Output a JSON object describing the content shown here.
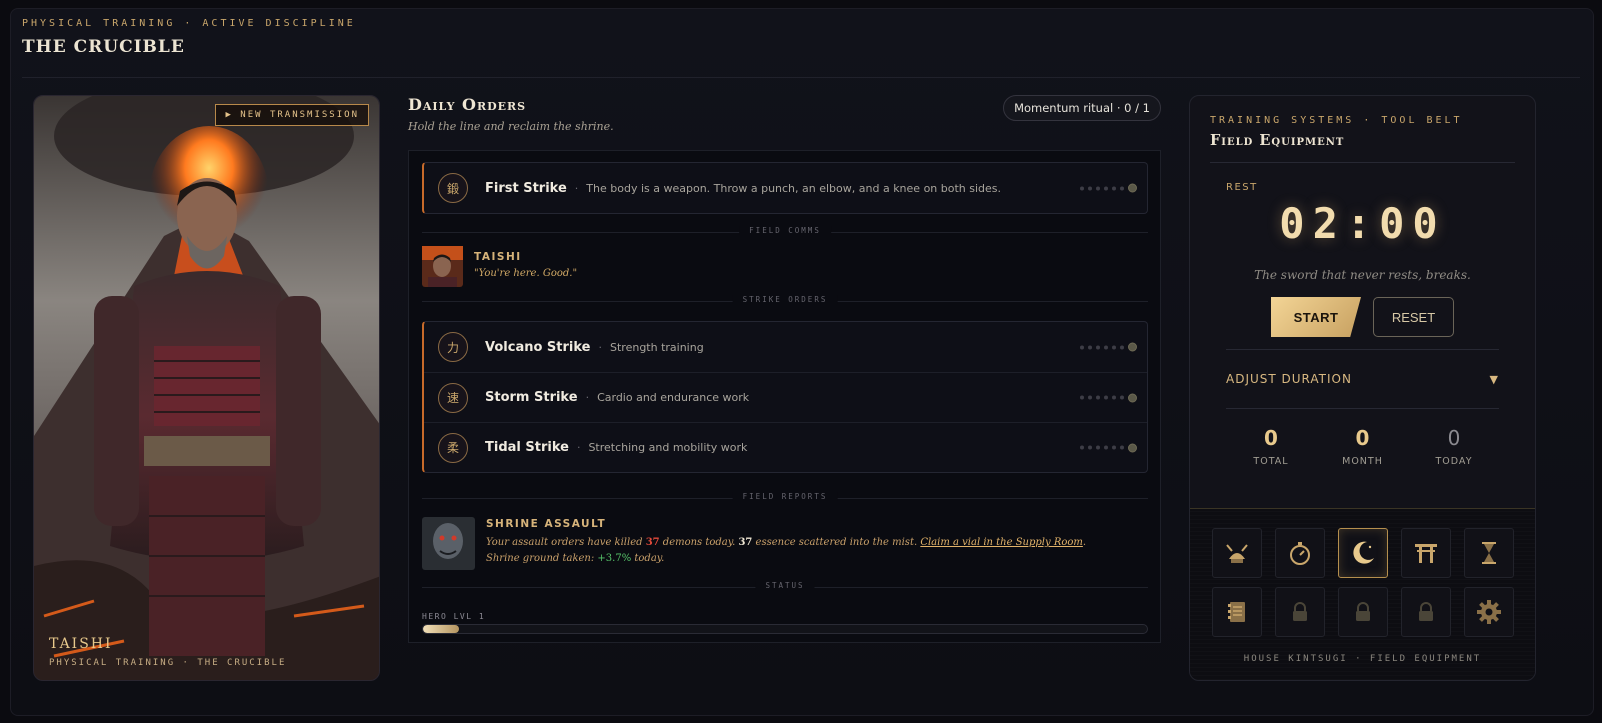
{
  "header": {
    "eyebrow": "PHYSICAL TRAINING · ACTIVE DISCIPLINE",
    "title": "THE CRUCIBLE"
  },
  "hero": {
    "badge": "▶ NEW TRANSMISSION",
    "name": "TAISHI",
    "subtitle": "PHYSICAL TRAINING · THE CRUCIBLE"
  },
  "orders": {
    "title": "Daily Orders",
    "subtitle": "Hold the line and reclaim the shrine.",
    "ritual": "Momentum ritual · 0 / 1",
    "first_strike": {
      "kanji": "鍛",
      "name": "First Strike",
      "sep": "·",
      "desc": "The body is a weapon. Throw a punch, an elbow, and a knee on both sides."
    },
    "dividers": {
      "comms": "FIELD COMMS",
      "strikes": "STRIKE ORDERS",
      "reports": "FIELD REPORTS",
      "status": "STATUS"
    },
    "comm": {
      "who": "TAISHI",
      "quote": "\"You're here. Good.\""
    },
    "strikes": [
      {
        "kanji": "力",
        "name": "Volcano Strike",
        "sep": "·",
        "desc": "Strength training"
      },
      {
        "kanji": "速",
        "name": "Storm Strike",
        "sep": "·",
        "desc": "Cardio and endurance work"
      },
      {
        "kanji": "柔",
        "name": "Tidal Strike",
        "sep": "·",
        "desc": "Stretching and mobility work"
      }
    ],
    "report": {
      "title": "SHRINE ASSAULT",
      "l1_a": "Your assault orders have killed ",
      "kills": "37",
      "l1_b": " demons today. ",
      "essence": "37",
      "l1_c": " essence scattered into the mist. ",
      "link": "Claim a vial in the Supply Room",
      "l1_d": ".",
      "l2_a": "Shrine ground taken: ",
      "gain": "+3.7%",
      "l2_b": " today."
    },
    "level": "HERO LVL 1",
    "xp_fraction": 0.05
  },
  "equipment": {
    "eyebrow": "TRAINING SYSTEMS · TOOL BELT",
    "title": "Field Equipment",
    "rest_label": "REST",
    "timer": "02:00",
    "motto": "The sword that never rests, breaks.",
    "start": "START",
    "reset": "RESET",
    "adjust": "ADJUST DURATION",
    "adjust_chev": "▼",
    "stats": [
      {
        "num": "0",
        "label": "TOTAL"
      },
      {
        "num": "0",
        "label": "MONTH"
      },
      {
        "num": "0",
        "label": "TODAY"
      }
    ],
    "tools": [
      "samurai-helmet-icon",
      "stopwatch-icon",
      "moon-icon",
      "torii-icon",
      "hourglass-icon",
      "journal-icon",
      "lock-icon",
      "lock-icon",
      "lock-icon",
      "gear-icon"
    ],
    "footer": "HOUSE KINTSUGI · FIELD EQUIPMENT"
  },
  "colors": {
    "accent": "#c9a66b",
    "border_accent": "#c76a2a",
    "bg": "#0b0b10"
  }
}
